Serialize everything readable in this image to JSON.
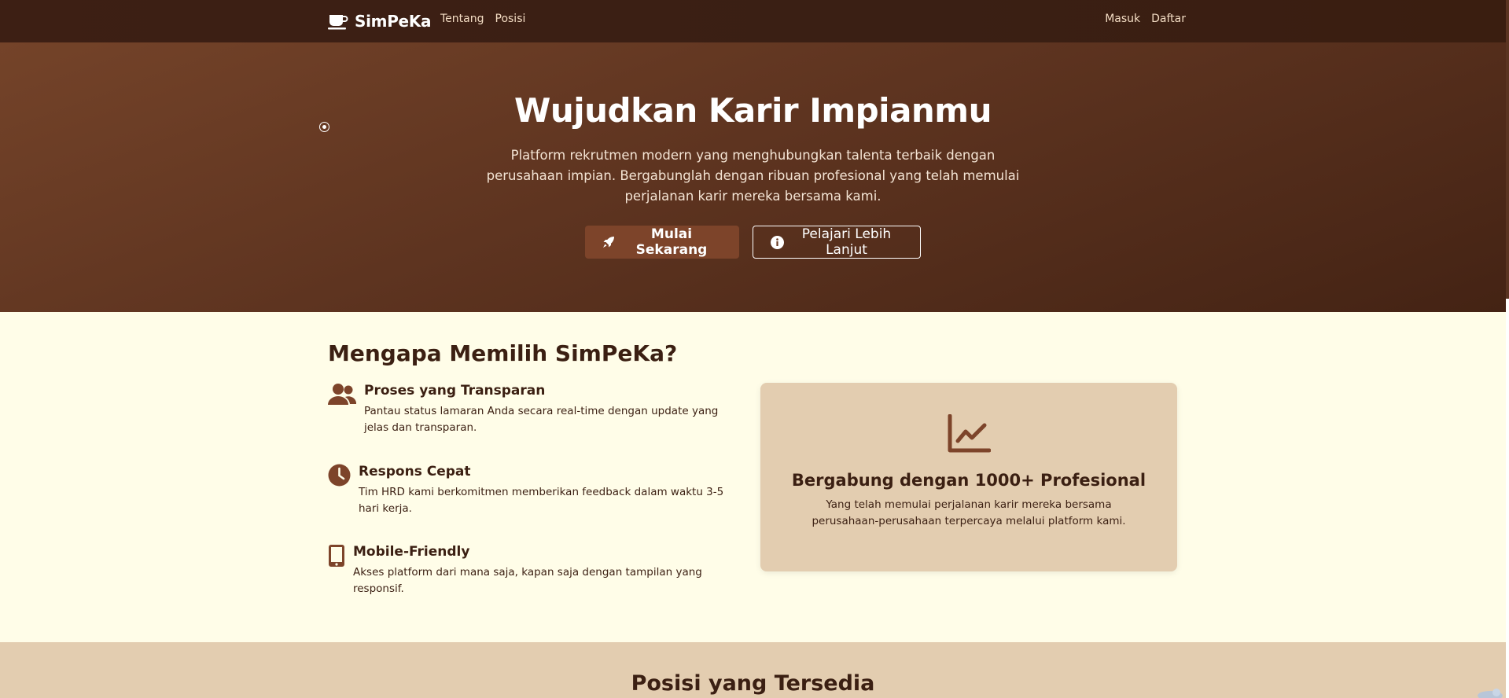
{
  "nav": {
    "brand": "SimPeKa",
    "left_links": [
      "Tentang",
      "Posisi"
    ],
    "right_links": [
      "Masuk",
      "Daftar"
    ]
  },
  "hero": {
    "title": "Wujudkan Karir Impianmu",
    "subtitle": "Platform rekrutmen modern yang menghubungkan talenta terbaik dengan perusahaan impian. Bergabunglah dengan ribuan profesional yang telah memulai perjalanan karir mereka bersama kami.",
    "primary_button": "Mulai Sekarang",
    "secondary_button": "Pelajari Lebih Lanjut"
  },
  "why": {
    "title": "Mengapa Memilih SimPeKa?",
    "features": [
      {
        "icon": "users-icon",
        "title": "Proses yang Transparan",
        "text": "Pantau status lamaran Anda secara real-time dengan update yang jelas dan transparan."
      },
      {
        "icon": "clock-icon",
        "title": "Respons Cepat",
        "text": "Tim HRD kami berkomitmen memberikan feedback dalam waktu 3-5 hari kerja."
      },
      {
        "icon": "mobile-icon",
        "title": "Mobile-Friendly",
        "text": "Akses platform dari mana saja, kapan saja dengan tampilan yang responsif."
      }
    ],
    "card": {
      "icon": "line-chart-icon",
      "title": "Bergabung dengan 1000+ Profesional",
      "text": "Yang telah memulai perjalanan karir mereka bersama perusahaan-perusahaan terpercaya melalui platform kami."
    }
  },
  "positions": {
    "title": "Posisi yang Tersedia"
  },
  "colors": {
    "nav_bg": "#3d1f14",
    "hero_bg": "#6a3b24",
    "accent": "#7d442a",
    "page_bg": "#fffde8",
    "card_bg": "#e3cdb0",
    "text_dark": "#3b1f12"
  }
}
